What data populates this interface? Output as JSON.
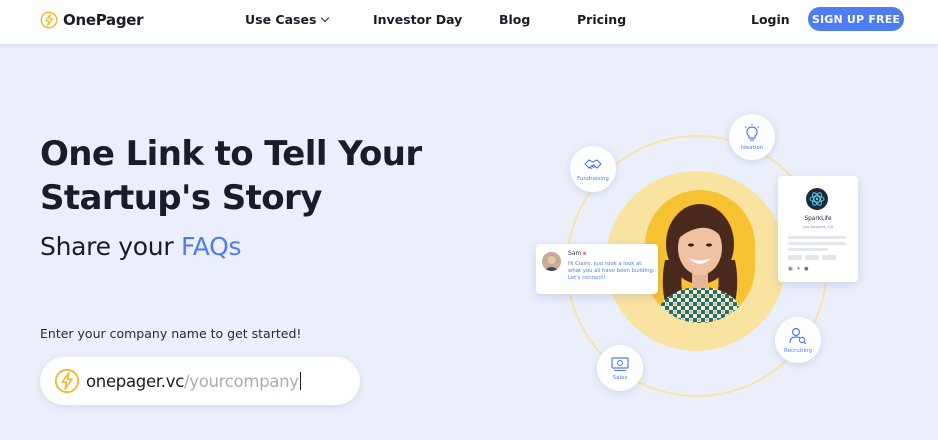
{
  "brand": {
    "name": "OnePager",
    "accent": "#4d7cf4",
    "logo_icon": "lightning-circle-icon"
  },
  "nav": {
    "use_cases": "Use Cases",
    "investor_day": "Investor Day",
    "blog": "Blog",
    "pricing": "Pricing",
    "login": "Login",
    "signup": "SIGN UP FREE"
  },
  "hero": {
    "title_line1": "One Link to Tell Your",
    "title_line2": "Startup's Story",
    "subtitle_prefix": "Share your ",
    "subtitle_accent": "FAQs",
    "prompt": "Enter your company name to get started!",
    "url_domain": "onepager.vc",
    "url_placeholder": "/yourcompany"
  },
  "illustration": {
    "bubbles": {
      "ideation": "Ideation",
      "fundraising": "Fundraising",
      "recruiting": "Recruiting",
      "sales": "Sales"
    },
    "message": {
      "name": "Sam",
      "text": "Hi Claire, just took a look at what you all have been building. Let's connect!"
    },
    "profile": {
      "name": "SparkLife",
      "location": "Los Angeles, CA"
    }
  }
}
